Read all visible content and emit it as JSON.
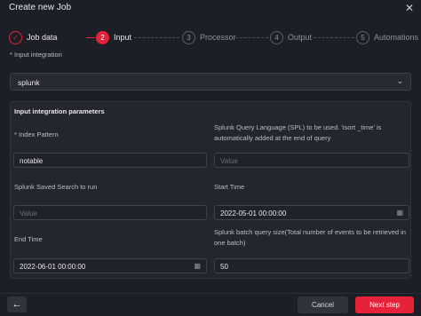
{
  "window": {
    "title": "Create new Job"
  },
  "stepper": {
    "steps": [
      {
        "number": "✓",
        "label": "Job data",
        "state": "done"
      },
      {
        "number": "2",
        "label": "Input",
        "state": "active"
      },
      {
        "number": "3",
        "label": "Processor",
        "state": "pending"
      },
      {
        "number": "4",
        "label": "Output",
        "state": "pending"
      },
      {
        "number": "5",
        "label": "Automations",
        "state": "pending"
      }
    ]
  },
  "input_integration": {
    "label": "Input integration",
    "required_mark": "*",
    "value": "splunk"
  },
  "parameters": {
    "title": "Input integration parameters",
    "index_pattern": {
      "label": "Index Pattern",
      "required_mark": "*",
      "value": "notable"
    },
    "spl": {
      "label": "Splunk Query Language (SPL) to be used. 'isort _time' is automatically added at the end of query",
      "placeholder": "Value"
    },
    "saved_search": {
      "label": "Splunk Saved Search to run",
      "placeholder": "Value"
    },
    "start_time": {
      "label": "Start Time",
      "value": "2022-05-01 00:00:00"
    },
    "end_time": {
      "label": "End Time",
      "value": "2022-06-01 00:00:00"
    },
    "batch_size": {
      "label": "Splunk batch query size(Total number of events to be retrieved in one batch)",
      "value": "50"
    }
  },
  "footer": {
    "cancel_label": "Cancel",
    "next_label": "Next step"
  },
  "colors": {
    "accent": "#e6213a",
    "background": "#1c1f26",
    "panel": "#23262e"
  },
  "icons": {
    "back": "arrow-left-icon",
    "close": "close-icon",
    "calendar": "calendar-icon",
    "chevron": "chevron-down-icon"
  }
}
